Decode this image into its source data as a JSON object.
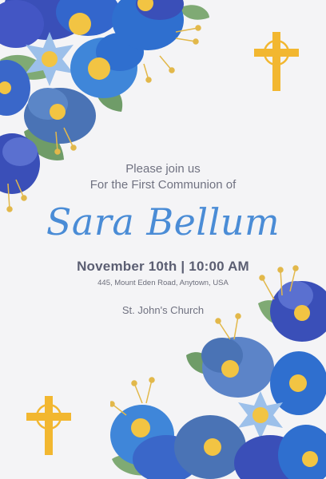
{
  "invitation": {
    "line1": "Please join us",
    "line2": "For the First Communion of",
    "name": "Sara Bellum",
    "date_time": "November 10th | 10:00 AM",
    "address": "445, Mount Eden Road, Anytown, USA",
    "venue": "St. John's Church"
  },
  "decorations": {
    "flower_icon": "blue-flower-cluster",
    "cross_icon": "gold-cross",
    "colors": {
      "background": "#f4f4f6",
      "name_blue": "#4a8cd6",
      "text_gray": "#707281",
      "cross_gold": "#f2b730",
      "petal_dark": "#3a4fb8",
      "petal_mid": "#3f86d9",
      "petal_light": "#8fb8e6",
      "leaf_green": "#7faa74",
      "center_yellow": "#f2c443"
    }
  }
}
